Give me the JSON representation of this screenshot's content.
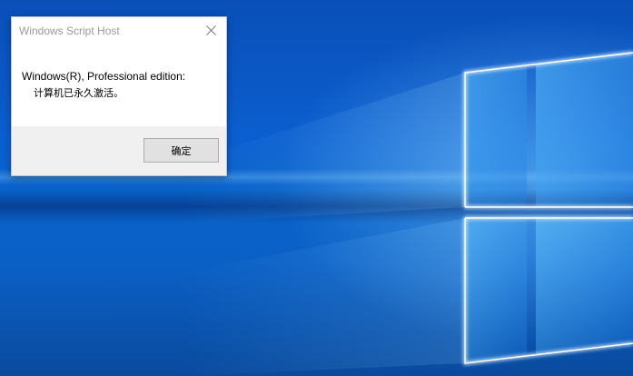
{
  "desktop": {
    "wallpaper": "windows-10-hero",
    "colors": {
      "background": "#0b5fd0",
      "logo_glow": "#d6f1ff"
    }
  },
  "dialog": {
    "title": "Windows Script Host",
    "close_icon": "close-icon",
    "message_line1": "Windows(R), Professional edition:",
    "message_line2": "计算机已永久激活。",
    "ok_label": "确定"
  }
}
